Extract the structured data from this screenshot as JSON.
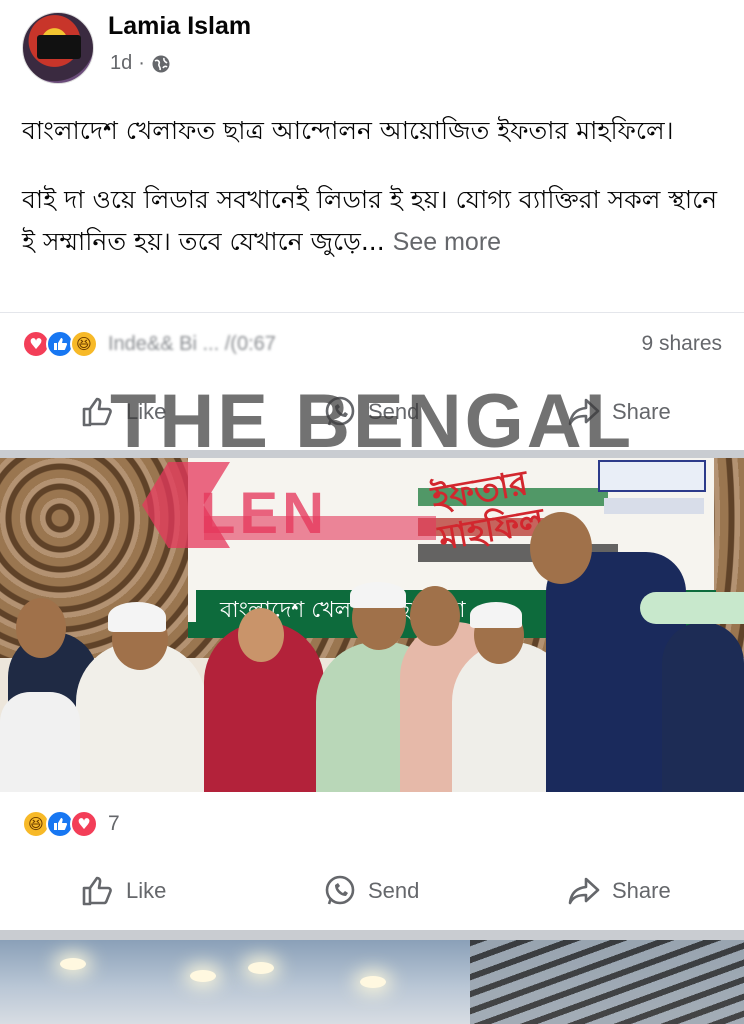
{
  "post": {
    "author": "Lamia Islam",
    "time": "1d",
    "dot": "·",
    "visibility_icon": "globe-icon",
    "paragraph1": "বাংলাদেশ খেলাফত ছাত্র আন্দোলন আয়োজিত ইফতার মাহফিলে।",
    "paragraph2": "বাই দা ওয়ে লিডার সবখানেই লিডার ই হয়। যোগ্য ব্যাক্তিরা সকল স্থানে ই সম্মানিত হয়। তবে যেখানে জুড়ে...",
    "see_more": "See more",
    "reaction_icons": [
      "love-icon",
      "like-icon",
      "haha-icon"
    ],
    "reactors_text": "Inde&& Bi ... /(0:67",
    "shares": "9 shares",
    "actions": {
      "like": "Like",
      "send": "Send",
      "share": "Share"
    }
  },
  "watermark": {
    "text": "THE BENGAL",
    "logo_text": "LEN"
  },
  "photo_banner": {
    "strip_text": "বাংলাদেশ খেলাফত ছাত্র আ",
    "red_title": "ইফতার মাহফিল"
  },
  "photo_post": {
    "reaction_icons": [
      "haha-icon",
      "like-icon",
      "love-icon"
    ],
    "reaction_count": "7",
    "actions": {
      "like": "Like",
      "send": "Send",
      "share": "Share"
    }
  },
  "colors": {
    "like_blue": "#1877f2",
    "love_red": "#f33e58",
    "haha_yellow": "#f7b928",
    "secondary_text": "#65676b",
    "separator": "#c9ccd1"
  }
}
